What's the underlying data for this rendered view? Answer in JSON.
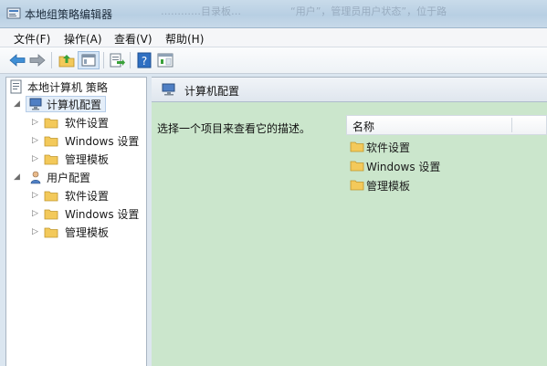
{
  "window": {
    "title": "本地组策略编辑器",
    "ghost_text_1": "…………目录板…",
    "ghost_text_2": "“用户”，管理员用户状态”，位于路"
  },
  "menubar": {
    "items": [
      {
        "label": "文件(F)"
      },
      {
        "label": "操作(A)"
      },
      {
        "label": "查看(V)"
      },
      {
        "label": "帮助(H)"
      }
    ]
  },
  "toolbar": {
    "buttons": [
      {
        "icon": "back-arrow-icon"
      },
      {
        "icon": "forward-arrow-icon"
      },
      {
        "icon": "up-folder-icon"
      },
      {
        "icon": "show-hide-console-tree-icon"
      },
      {
        "icon": "export-list-icon"
      },
      {
        "icon": "help-icon"
      },
      {
        "icon": "show-hide-action-pane-icon"
      }
    ]
  },
  "tree": {
    "root": {
      "label": "本地计算机 策略",
      "icon": "policy-icon"
    },
    "computer": {
      "label": "计算机配置",
      "icon": "computer-icon"
    },
    "computer_children": [
      {
        "label": "软件设置",
        "icon": "folder-icon"
      },
      {
        "label": "Windows 设置",
        "icon": "folder-icon"
      },
      {
        "label": "管理模板",
        "icon": "folder-icon"
      }
    ],
    "user": {
      "label": "用户配置",
      "icon": "user-icon"
    },
    "user_children": [
      {
        "label": "软件设置",
        "icon": "folder-icon"
      },
      {
        "label": "Windows 设置",
        "icon": "folder-icon"
      },
      {
        "label": "管理模板",
        "icon": "folder-icon"
      }
    ]
  },
  "details": {
    "header": "计算机配置",
    "description": "选择一个项目来查看它的描述。",
    "column_name": "名称",
    "items": [
      {
        "label": "软件设置"
      },
      {
        "label": "Windows 设置"
      },
      {
        "label": "管理模板"
      }
    ]
  },
  "colors": {
    "details_background": "#cbe6cc",
    "folder": "#f3c95a",
    "selection": "#e4eef9"
  }
}
